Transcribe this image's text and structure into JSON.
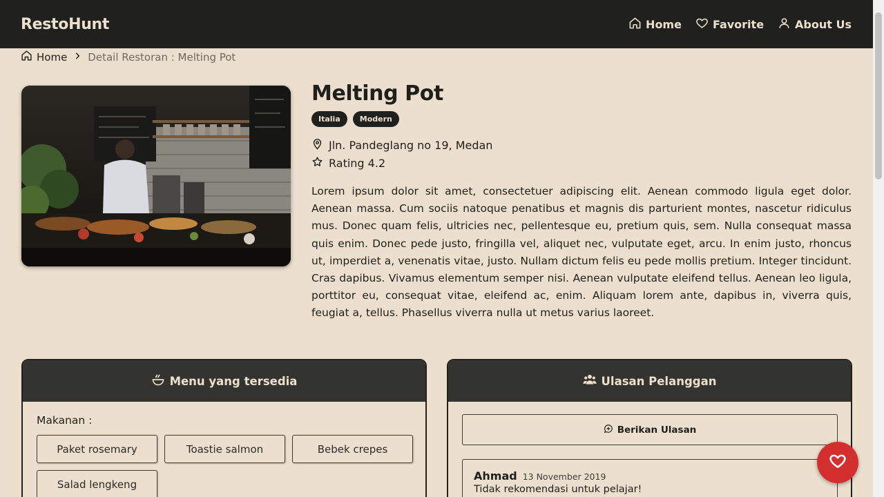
{
  "header": {
    "brand": "RestoHunt",
    "nav": [
      {
        "label": "Home",
        "icon": "home-icon"
      },
      {
        "label": "Favorite",
        "icon": "heart-icon"
      },
      {
        "label": "About Us",
        "icon": "user-icon"
      }
    ]
  },
  "breadcrumb": {
    "home": "Home",
    "current": "Detail Restoran : Melting Pot"
  },
  "restaurant": {
    "name": "Melting Pot",
    "tags": [
      "Italia",
      "Modern"
    ],
    "address": "Jln. Pandeglang no 19, Medan",
    "rating": "Rating 4.2",
    "description": "Lorem ipsum dolor sit amet, consectetuer adipiscing elit. Aenean commodo ligula eget dolor. Aenean massa. Cum sociis natoque penatibus et magnis dis parturient montes, nascetur ridiculus mus. Donec quam felis, ultricies nec, pellentesque eu, pretium quis, sem. Nulla consequat massa quis enim. Donec pede justo, fringilla vel, aliquet nec, vulputate eget, arcu. In enim justo, rhoncus ut, imperdiet a, venenatis vitae, justo. Nullam dictum felis eu pede mollis pretium. Integer tincidunt. Cras dapibus. Vivamus elementum semper nisi. Aenean vulputate eleifend tellus. Aenean leo ligula, porttitor eu, consequat vitae, eleifend ac, enim. Aliquam lorem ante, dapibus in, viverra quis, feugiat a, tellus. Phasellus viverra nulla ut metus varius laoreet."
  },
  "menu": {
    "title": "Menu yang tersedia",
    "food_label": "Makanan :",
    "foods": [
      "Paket rosemary",
      "Toastie salmon",
      "Bebek crepes",
      "Salad lengkeng"
    ]
  },
  "reviews": {
    "title": "Ulasan Pelanggan",
    "give_review_label": "Berikan Ulasan",
    "items": [
      {
        "name": "Ahmad",
        "date": "13 November 2019",
        "text": "Tidak rekomendasi untuk pelajar!"
      }
    ]
  },
  "colors": {
    "background": "#ecdfce",
    "header": "#20211e",
    "fab": "#d32f2f"
  }
}
